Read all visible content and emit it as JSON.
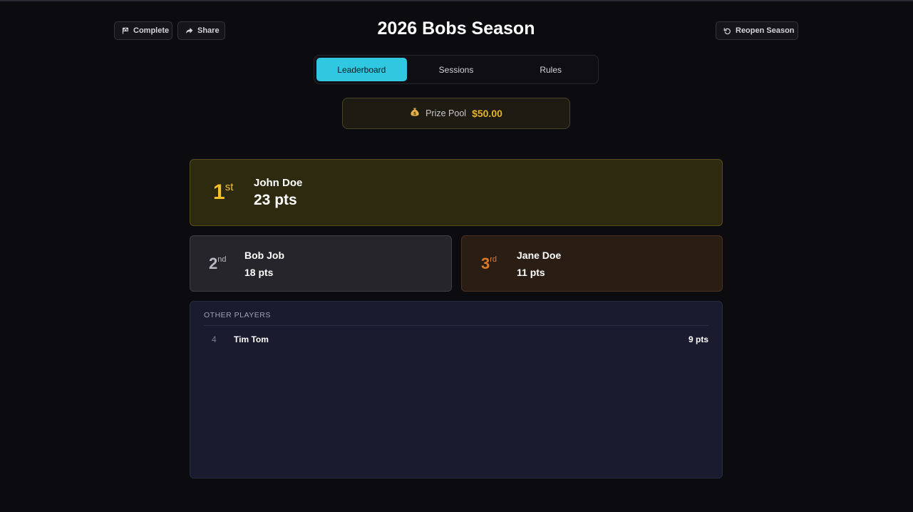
{
  "header": {
    "title": "2026 Bobs Season",
    "complete_label": "Complete",
    "share_label": "Share",
    "reopen_label": "Reopen Season"
  },
  "tabs": [
    {
      "label": "Leaderboard",
      "active": true
    },
    {
      "label": "Sessions",
      "active": false
    },
    {
      "label": "Rules",
      "active": false
    }
  ],
  "prize_pool": {
    "icon": "money-bag-icon",
    "label": "Prize Pool",
    "value": "$50.00"
  },
  "podium": [
    {
      "rank": "1",
      "suffix": "st",
      "name": "John Doe",
      "points": "23 pts",
      "color": "#f2c12a"
    },
    {
      "rank": "2",
      "suffix": "nd",
      "name": "Bob Job",
      "points": "18 pts",
      "color": "#b8b8c0"
    },
    {
      "rank": "3",
      "suffix": "rd",
      "name": "Jane Doe",
      "points": "11 pts",
      "color": "#d97a2a"
    }
  ],
  "other_players": {
    "heading": "OTHER PLAYERS",
    "rows": [
      {
        "rank": "4",
        "name": "Tim Tom",
        "points": "9 pts"
      }
    ]
  },
  "colors": {
    "accent": "#2fc8e0",
    "gold": "#e6b422",
    "background": "#0c0c10"
  }
}
